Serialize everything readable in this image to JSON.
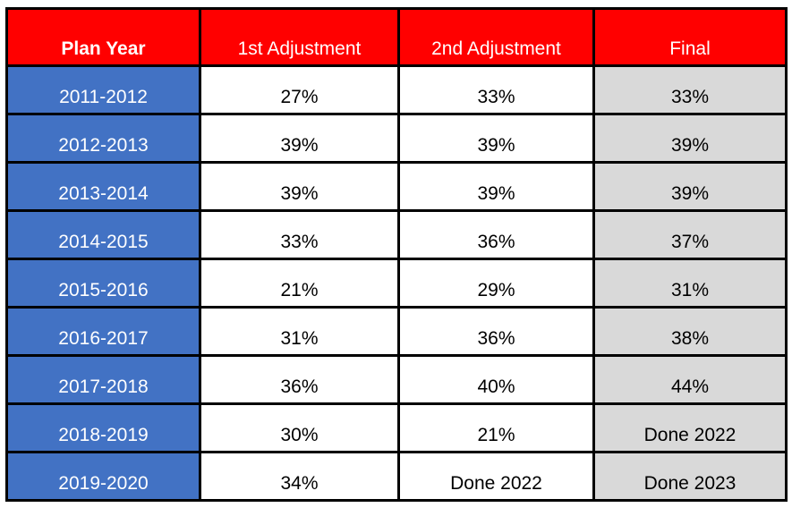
{
  "table": {
    "columns": [
      {
        "key": "plan_year",
        "label": "Plan Year"
      },
      {
        "key": "adj1",
        "label": "1st Adjustment"
      },
      {
        "key": "adj2",
        "label": "2nd Adjustment"
      },
      {
        "key": "final",
        "label": "Final"
      }
    ],
    "rows": [
      {
        "plan_year": "2011-2012",
        "adj1": "27%",
        "adj2": "33%",
        "final": "33%"
      },
      {
        "plan_year": "2012-2013",
        "adj1": "39%",
        "adj2": "39%",
        "final": "39%"
      },
      {
        "plan_year": "2013-2014",
        "adj1": "39%",
        "adj2": "39%",
        "final": "39%"
      },
      {
        "plan_year": "2014-2015",
        "adj1": "33%",
        "adj2": "36%",
        "final": "37%"
      },
      {
        "plan_year": "2015-2016",
        "adj1": "21%",
        "adj2": "29%",
        "final": "31%"
      },
      {
        "plan_year": "2016-2017",
        "adj1": "31%",
        "adj2": "36%",
        "final": "38%"
      },
      {
        "plan_year": "2017-2018",
        "adj1": "36%",
        "adj2": "40%",
        "final": "44%"
      },
      {
        "plan_year": "2018-2019",
        "adj1": "30%",
        "adj2": "21%",
        "final": "Done 2022"
      },
      {
        "plan_year": "2019-2020",
        "adj1": "34%",
        "adj2": "Done 2022",
        "final": "Done 2023"
      }
    ]
  },
  "colors": {
    "header_background": "#FF0000",
    "header_text": "#FFFFFF",
    "year_column_background": "#4272C4",
    "year_column_text": "#FFFFFF",
    "adjustment_column_background": "#FFFFFF",
    "final_column_background": "#D9D9D9",
    "body_text": "#000000",
    "border": "#000000"
  }
}
